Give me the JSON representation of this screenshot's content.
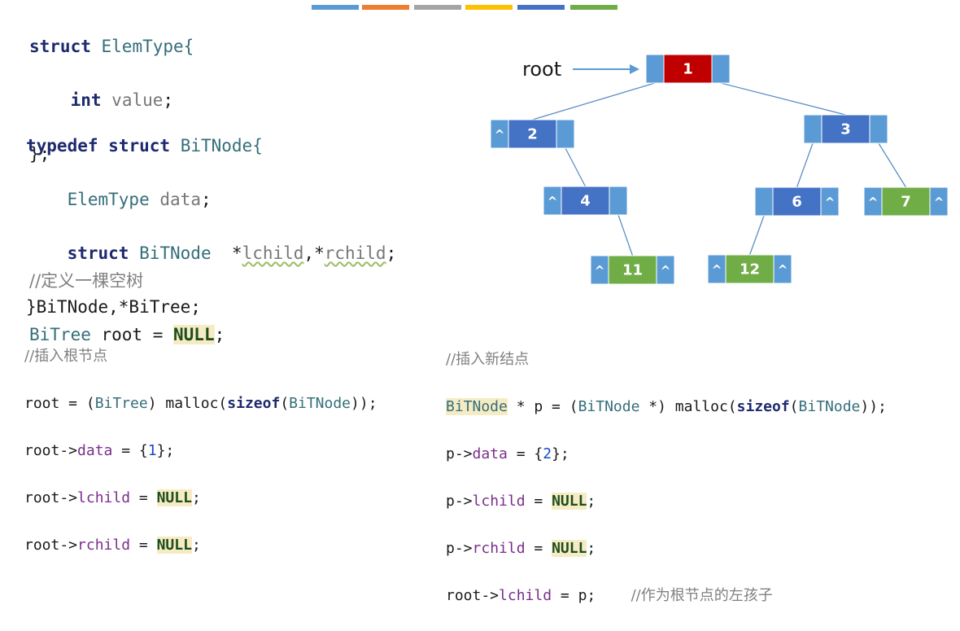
{
  "colors": {
    "blue": "#5b9bd5",
    "dark_blue": "#4472c4",
    "red": "#c00000",
    "green": "#70ad47",
    "top_bars": [
      "#5b9bd5",
      "#ed7d31",
      "#a5a5a5",
      "#ffc000",
      "#4472c4",
      "#70ad47"
    ]
  },
  "code_left": {
    "elemtype": {
      "struct_kw": "struct",
      "name": "ElemType{",
      "int_kw": "int",
      "field": "value",
      "semi": ";",
      "close": "};"
    },
    "bitnode": {
      "typedef_kw": "typedef",
      "struct_kw": "struct",
      "name": "BiTNode{",
      "data_type": "ElemType",
      "data_field": "data",
      "semi": ";",
      "struct_kw2": "struct",
      "type2": "BiTNode",
      "star1": "*",
      "lchild": "lchild",
      "comma": ",*",
      "rchild": "rchild",
      "semi2": ";",
      "close": "}BiTNode,*BiTree;"
    },
    "empty_tree": {
      "comment": "//定义一棵空树",
      "type": "BiTree",
      "rest": " root = ",
      "null": "NULL",
      "semi": ";"
    }
  },
  "code_root": {
    "comment": "//插入根节点",
    "l1": {
      "a": "root = (",
      "type1": "BiTree",
      "b": ") malloc(",
      "kw": "sizeof",
      "c": "(",
      "type2": "BiTNode",
      "d": "));"
    },
    "l2": {
      "a": "root->",
      "field": "data",
      "b": " = {",
      "num": "1",
      "c": "};"
    },
    "l3": {
      "a": "root->",
      "field": "lchild",
      "b": " = ",
      "null": "NULL",
      "c": ";"
    },
    "l4": {
      "a": "root->",
      "field": "rchild",
      "b": " = ",
      "null": "NULL",
      "c": ";"
    }
  },
  "code_new": {
    "comment": "//插入新结点",
    "l1": {
      "type1": "BiTNode",
      "a": " * p = (",
      "type2": "BiTNode",
      "b": " *) malloc(",
      "kw": "sizeof",
      "c": "(",
      "type3": "BiTNode",
      "d": "));"
    },
    "l2": {
      "a": "p->",
      "field": "data",
      "b": " = {",
      "num": "2",
      "c": "};"
    },
    "l3": {
      "a": "p->",
      "field": "lchild",
      "b": " = ",
      "null": "NULL",
      "c": ";"
    },
    "l4": {
      "a": "p->",
      "field": "rchild",
      "b": " = ",
      "null": "NULL",
      "c": ";"
    },
    "l5": {
      "a": "root->",
      "field": "lchild",
      "b": " = p;",
      "comment": "//作为根节点的左孩子"
    }
  },
  "tree": {
    "root_label": "root",
    "null_mark": "^",
    "nodes": [
      {
        "id": "n1",
        "value": "1",
        "color": "red",
        "left_null": false,
        "right_null": false
      },
      {
        "id": "n2",
        "value": "2",
        "color": "dark_blue",
        "left_null": true,
        "right_null": false
      },
      {
        "id": "n3",
        "value": "3",
        "color": "dark_blue",
        "left_null": false,
        "right_null": false
      },
      {
        "id": "n4",
        "value": "4",
        "color": "dark_blue",
        "left_null": true,
        "right_null": false
      },
      {
        "id": "n6",
        "value": "6",
        "color": "dark_blue",
        "left_null": false,
        "right_null": true
      },
      {
        "id": "n7",
        "value": "7",
        "color": "green",
        "left_null": true,
        "right_null": true
      },
      {
        "id": "n11",
        "value": "11",
        "color": "green",
        "left_null": true,
        "right_null": true
      },
      {
        "id": "n12",
        "value": "12",
        "color": "green",
        "left_null": true,
        "right_null": true
      }
    ],
    "edges": [
      [
        "n1",
        "n2"
      ],
      [
        "n1",
        "n3"
      ],
      [
        "n2",
        "n4"
      ],
      [
        "n3",
        "n6"
      ],
      [
        "n3",
        "n7"
      ],
      [
        "n4",
        "n11"
      ],
      [
        "n6",
        "n12"
      ]
    ]
  }
}
